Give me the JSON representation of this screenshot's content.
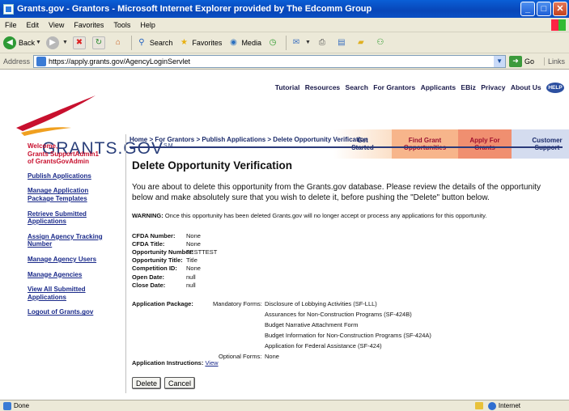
{
  "window": {
    "title": "Grants.gov - Grantors - Microsoft Internet Explorer provided by The Edcomm Group",
    "buttons": [
      "_",
      "□",
      "✕"
    ]
  },
  "menu": [
    "File",
    "Edit",
    "View",
    "Favorites",
    "Tools",
    "Help"
  ],
  "toolbar": {
    "back": "Back",
    "search": "Search",
    "favorites": "Favorites",
    "media": "Media"
  },
  "address": {
    "label": "Address",
    "url": "https://apply.grants.gov/AgencyLoginServlet",
    "go": "Go",
    "links": "Links"
  },
  "header": {
    "topnav": [
      "Tutorial",
      "Resources",
      "Search",
      "For Grantors",
      "Applicants",
      "EBiz",
      "Privacy",
      "About Us"
    ],
    "help": "HELP",
    "logo": "GRANTS.GOV",
    "logo_sup": "SM",
    "tabs": {
      "get_started": "Get\nStarted",
      "find": "Find Grant\nOpportunities",
      "apply": "Apply For\nGrants",
      "support": "Customer\nSupport"
    },
    "colors": {
      "brand_blue": "#2a3f7a",
      "accent_red": "#c8102e",
      "tab_orange": "#f7b58b"
    }
  },
  "leftnav": {
    "welcome": "Welcome,\nGrants SupportAdmin1\nof GrantsGovAdmin",
    "links": [
      "Publish Applications",
      "Manage Application\nPackage Templates",
      "Retrieve Submitted\nApplications",
      "Assign Agency Tracking\nNumber",
      "Manage Agency Users",
      "Manage Agencies",
      "View All Submitted\nApplications",
      "Logout of Grants.gov"
    ]
  },
  "main": {
    "breadcrumb": "Home > For Grantors > Publish Applications > Delete Opportunity Verification",
    "title": "Delete Opportunity Verification",
    "intro": "You are about to delete this opportunity from the Grants.gov database. Please review the details of the opportunity below and make absolutely sure that you wish to delete it, before pushing the \"Delete\" button below.",
    "warning_label": "WARNING:",
    "warning_text": " Once this opportunity has been deleted Grants.gov will no longer accept or process any applications for this opportunity.",
    "details": [
      {
        "label": "CFDA Number:",
        "value": "None"
      },
      {
        "label": "CFDA Title:",
        "value": "None"
      },
      {
        "label": "Opportunity Number:",
        "value": "TESTTEST"
      },
      {
        "label": "Opportunity Title:",
        "value": "Title"
      },
      {
        "label": "Competition ID:",
        "value": "None"
      },
      {
        "label": "Open Date:",
        "value": "null"
      },
      {
        "label": "Close Date:",
        "value": "null"
      }
    ],
    "package": {
      "label": "Application Package:",
      "mandatory_label": "Mandatory Forms:",
      "mandatory": [
        "Disclosure of Lobbying Activities (SF-LLL)",
        "Assurances for Non-Construction Programs (SF-424B)",
        "Budget Narrative Attachment Form",
        "Budget Information for Non-Construction Programs (SF-424A)",
        "Application for Federal Assistance (SF-424)"
      ],
      "optional_label": "Optional Forms:",
      "optional": "None"
    },
    "instructions_label": "Application Instructions:",
    "instructions_link": "View",
    "delete_button": "Delete",
    "cancel_button": "Cancel"
  },
  "status": {
    "text": "Done",
    "zone": "Internet"
  }
}
